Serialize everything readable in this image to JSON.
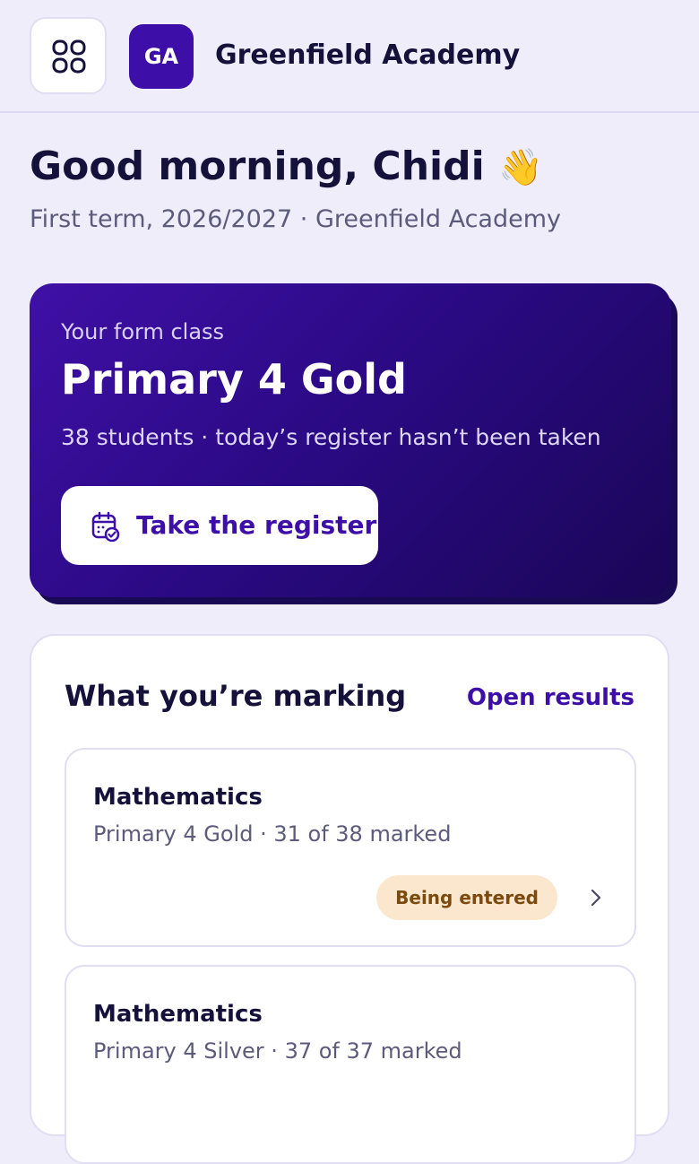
{
  "header": {
    "logo_text": "GA",
    "school_name": "Greenfield Academy",
    "menu_icon": "grid-icon"
  },
  "greeting": {
    "text": "Good morning, Chidi",
    "emoji": "👋",
    "subtitle": "First term, 2026/2027 · Greenfield Academy"
  },
  "form_class": {
    "eyebrow": "Your form class",
    "class_name": "Primary 4 Gold",
    "meta": "38 students · today’s register hasn’t been taken",
    "button_label": "Take the register",
    "button_icon": "calendar-check-icon"
  },
  "marking": {
    "title": "What you’re marking",
    "link_label": "Open results",
    "items": [
      {
        "subject": "Mathematics",
        "detail": "Primary 4 Gold · 31 of 38 marked",
        "status": "Being entered"
      },
      {
        "subject": "Mathematics",
        "detail": "Primary 4 Silver · 37 of 37 marked"
      }
    ]
  },
  "colors": {
    "brand": "#3d0fa8",
    "background": "#efedfa",
    "badge_bg": "#fbe7cd",
    "badge_text": "#7a4a0e"
  }
}
